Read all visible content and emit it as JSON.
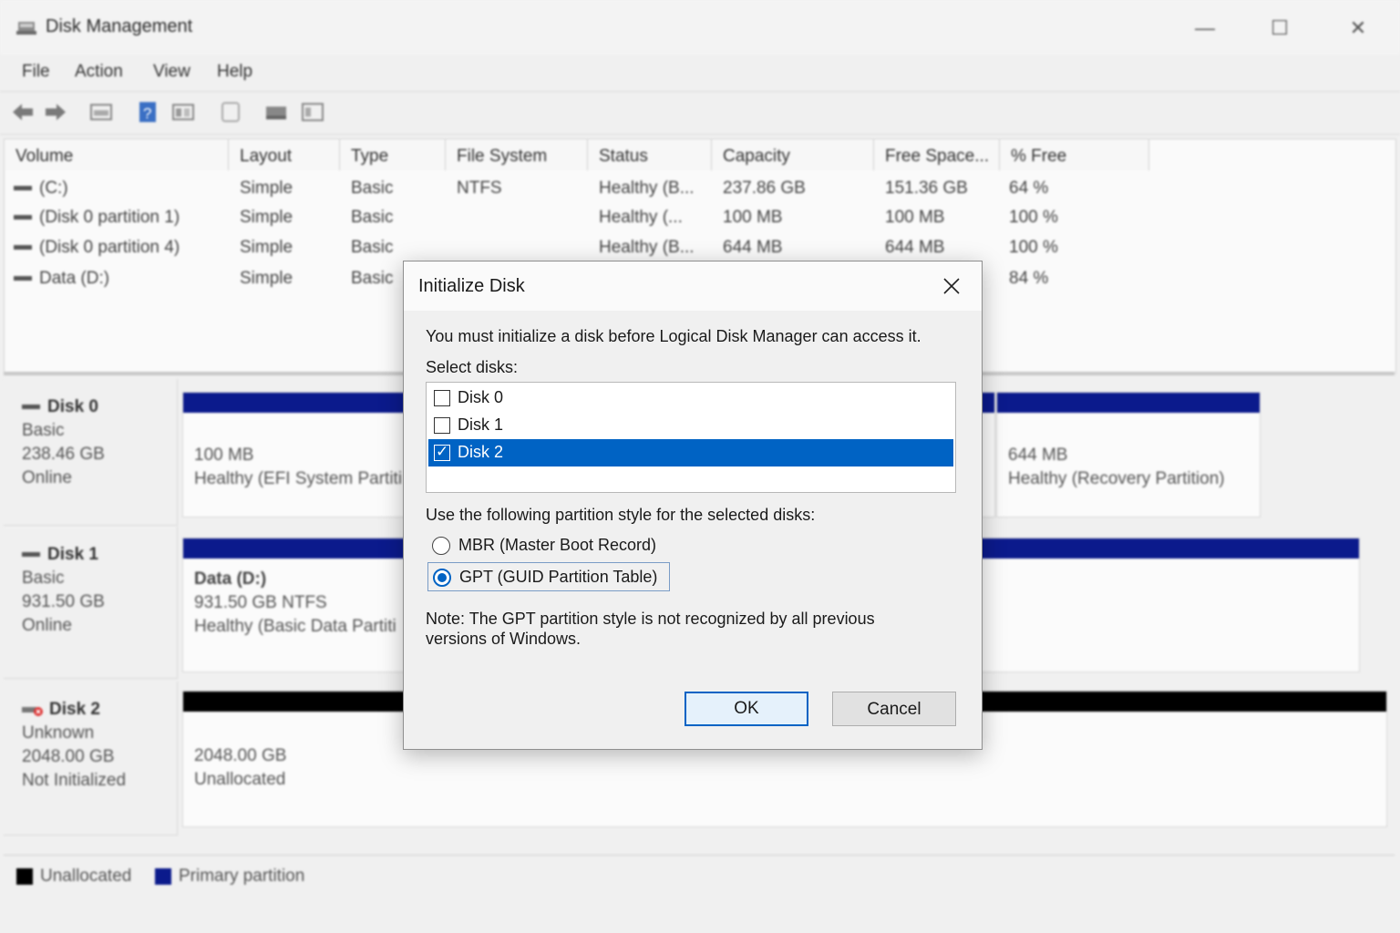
{
  "app": {
    "title": "Disk Management",
    "menu": [
      "File",
      "Action",
      "View",
      "Help"
    ],
    "window_controls": {
      "minimize": "—",
      "maximize": "☐",
      "close": "✕"
    }
  },
  "volume_list": {
    "columns": [
      "Volume",
      "Layout",
      "Type",
      "File System",
      "Status",
      "Capacity",
      "Free Space...",
      "% Free"
    ],
    "rows": [
      [
        "(C:)",
        "Simple",
        "Basic",
        "NTFS",
        "Healthy (B...",
        "237.86 GB",
        "151.36 GB",
        "64 %"
      ],
      [
        "(Disk 0 partition 1)",
        "Simple",
        "Basic",
        "",
        "Healthy (...",
        "100 MB",
        "100 MB",
        "100 %"
      ],
      [
        "(Disk 0 partition 4)",
        "Simple",
        "Basic",
        "",
        "Healthy (B...",
        "644 MB",
        "644 MB",
        "100 %"
      ],
      [
        "Data (D:)",
        "Simple",
        "Basic",
        "",
        "",
        "",
        "",
        "84 %"
      ]
    ]
  },
  "disks": [
    {
      "name": "Disk 0",
      "type": "Basic",
      "size": "238.46 GB",
      "state": "Online",
      "partitions": [
        {
          "line1": "100 MB",
          "line2": "Healthy (EFI System Partiti"
        },
        {
          "line1": "644 MB",
          "line2": "Healthy (Recovery Partition)"
        }
      ]
    },
    {
      "name": "Disk 1",
      "type": "Basic",
      "size": "931.50 GB",
      "state": "Online",
      "partitions": [
        {
          "line1": "Data  (D:)",
          "line2": "931.50 GB NTFS",
          "line3": "Healthy (Basic Data Partiti"
        }
      ]
    },
    {
      "name": "Disk 2",
      "type": "Unknown",
      "size": "2048.00 GB",
      "state": "Not Initialized",
      "partitions": [
        {
          "line1": "2048.00 GB",
          "line2": "Unallocated"
        }
      ]
    }
  ],
  "legend": [
    {
      "label": "Unallocated",
      "color": "#000000"
    },
    {
      "label": "Primary partition",
      "color": "#0b1a8c"
    }
  ],
  "dialog": {
    "title": "Initialize Disk",
    "intro": "You must initialize a disk before Logical Disk Manager can access it.",
    "select_label": "Select disks:",
    "disks": [
      {
        "label": "Disk 0",
        "checked": false,
        "selected": false
      },
      {
        "label": "Disk 1",
        "checked": false,
        "selected": false
      },
      {
        "label": "Disk 2",
        "checked": true,
        "selected": true
      }
    ],
    "style_label": "Use the following partition style for the selected disks:",
    "options": [
      {
        "label": "MBR (Master Boot Record)",
        "selected": false
      },
      {
        "label": "GPT (GUID Partition Table)",
        "selected": true
      }
    ],
    "note_line1": "Note: The GPT partition style is not recognized by all previous",
    "note_line2": "versions of Windows.",
    "ok": "OK",
    "cancel": "Cancel"
  },
  "colors": {
    "primary_partition": "#0b1a8c",
    "unallocated": "#000000",
    "selection": "#0063c4"
  }
}
